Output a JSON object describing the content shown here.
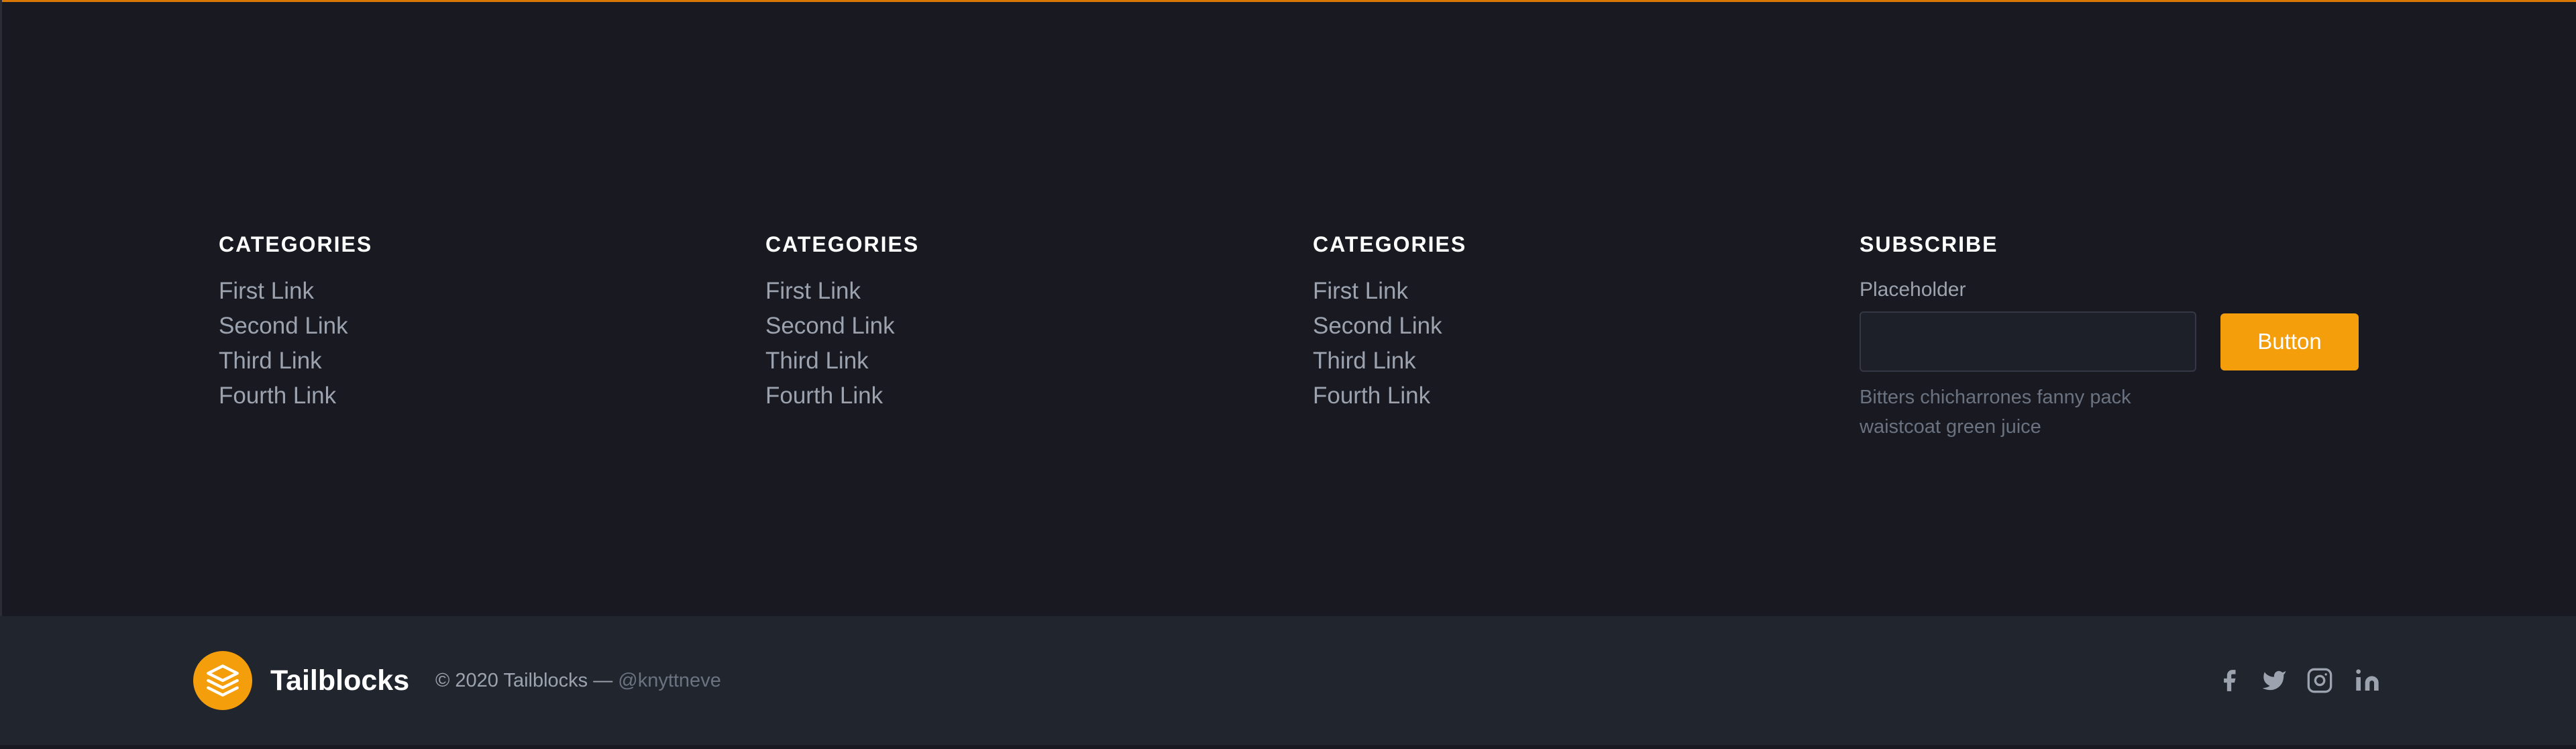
{
  "columns": [
    {
      "title": "CATEGORIES",
      "links": [
        "First Link",
        "Second Link",
        "Third Link",
        "Fourth Link"
      ]
    },
    {
      "title": "CATEGORIES",
      "links": [
        "First Link",
        "Second Link",
        "Third Link",
        "Fourth Link"
      ]
    },
    {
      "title": "CATEGORIES",
      "links": [
        "First Link",
        "Second Link",
        "Third Link",
        "Fourth Link"
      ]
    }
  ],
  "subscribe": {
    "title": "SUBSCRIBE",
    "label": "Placeholder",
    "input_value": "",
    "button_label": "Button",
    "helper_text": "Bitters chicharrones fanny pack waistcoat green juice"
  },
  "footer": {
    "brand": "Tailblocks",
    "copyright": "© 2020 Tailblocks —",
    "handle": "@knyttneve",
    "social_icons": [
      "facebook-icon",
      "twitter-icon",
      "instagram-icon",
      "linkedin-icon"
    ]
  },
  "colors": {
    "accent": "#f59e0b",
    "background": "#181921",
    "bottom_bar": "#21252d"
  }
}
